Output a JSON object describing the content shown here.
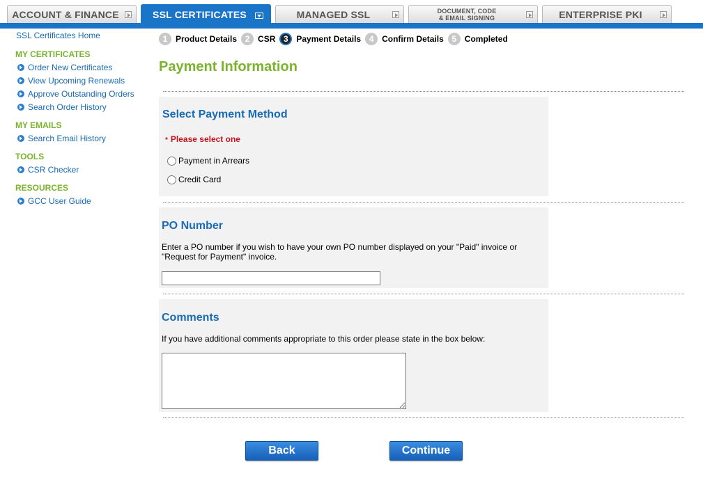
{
  "tabs": [
    {
      "label": "ACCOUNT & FINANCE",
      "active": false
    },
    {
      "label": "SSL CERTIFICATES",
      "active": true
    },
    {
      "label": "MANAGED SSL",
      "active": false
    },
    {
      "label": "DOCUMENT, CODE\n& EMAIL SIGNING",
      "active": false
    },
    {
      "label": "ENTERPRISE PKI",
      "active": false
    }
  ],
  "sidebar": {
    "home": "SSL Certificates Home",
    "sections": [
      {
        "heading": "MY CERTIFICATES",
        "links": [
          "Order New Certificates",
          "View Upcoming Renewals",
          "Approve Outstanding Orders",
          "Search Order History"
        ]
      },
      {
        "heading": "MY EMAILS",
        "links": [
          "Search Email History"
        ]
      },
      {
        "heading": "TOOLS",
        "links": [
          "CSR Checker"
        ]
      },
      {
        "heading": "RESOURCES",
        "links": [
          "GCC User Guide"
        ]
      }
    ]
  },
  "steps": [
    {
      "num": "1",
      "label": "Product Details"
    },
    {
      "num": "2",
      "label": "CSR"
    },
    {
      "num": "3",
      "label": "Payment Details"
    },
    {
      "num": "4",
      "label": "Confirm Details"
    },
    {
      "num": "5",
      "label": "Completed"
    }
  ],
  "page_title": "Payment Information",
  "payment": {
    "title": "Select Payment Method",
    "required_star": "*",
    "required_text": "Please select one",
    "options": [
      "Payment in Arrears",
      "Credit Card"
    ]
  },
  "po": {
    "title": "PO Number",
    "help": "Enter a PO number if you wish to have your own PO number displayed on your \"Paid\" invoice or \"Request for Payment\" invoice.",
    "value": ""
  },
  "comments": {
    "title": "Comments",
    "help": "If you have additional comments appropriate to this order please state in the box below:",
    "value": ""
  },
  "buttons": {
    "back": "Back",
    "continue": "Continue"
  },
  "colors": {
    "brand_blue": "#1a74c8",
    "link": "#1a6bb5",
    "heading_green": "#7ab32c",
    "required_red": "#c0141b"
  }
}
